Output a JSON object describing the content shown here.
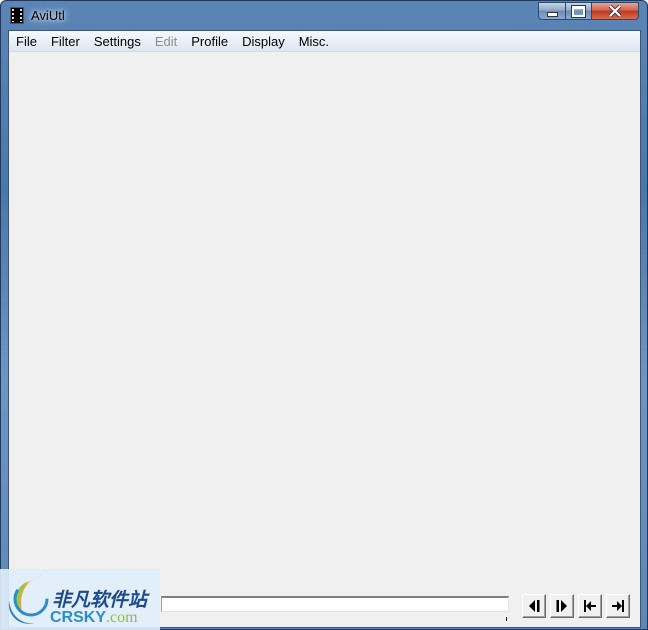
{
  "window": {
    "title": "AviUtl",
    "icon": "film-strip-icon",
    "caption_buttons": [
      "minimize",
      "maximize",
      "close"
    ]
  },
  "menubar": {
    "items": [
      {
        "label": "File",
        "enabled": true
      },
      {
        "label": "Filter",
        "enabled": true
      },
      {
        "label": "Settings",
        "enabled": true
      },
      {
        "label": "Edit",
        "enabled": false
      },
      {
        "label": "Profile",
        "enabled": true
      },
      {
        "label": "Display",
        "enabled": true
      },
      {
        "label": "Misc.",
        "enabled": true
      }
    ]
  },
  "seekbar": {
    "position": 0
  },
  "navigation": {
    "buttons": [
      {
        "name": "prev-frame",
        "icon": "prev-frame-icon"
      },
      {
        "name": "next-frame",
        "icon": "next-frame-icon"
      },
      {
        "name": "first-frame",
        "icon": "first-frame-icon"
      },
      {
        "name": "last-frame",
        "icon": "last-frame-icon"
      }
    ]
  },
  "watermark": {
    "chinese_text": "非凡软件站",
    "brand": "CRSKY",
    "domain_suffix": ".com"
  }
}
